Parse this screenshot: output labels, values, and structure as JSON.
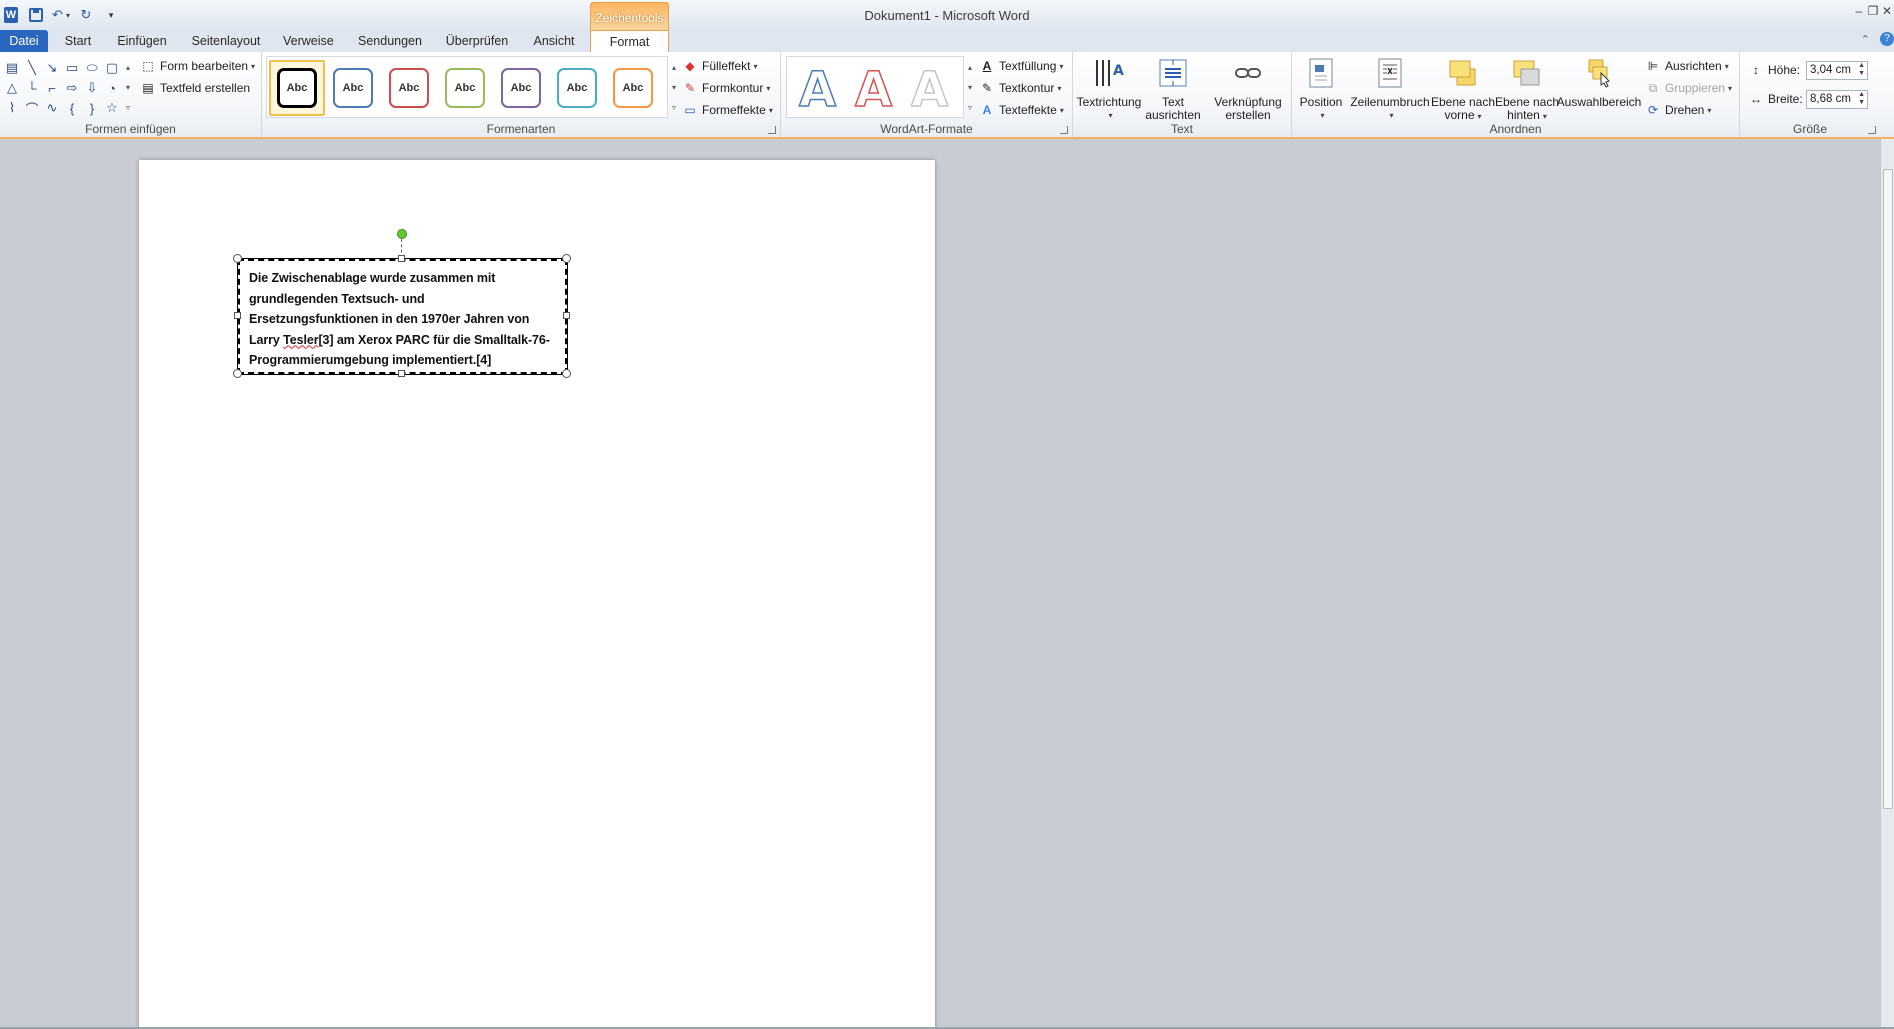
{
  "window": {
    "title": "Dokument1 - Microsoft Word",
    "context_group": "Zeichentools"
  },
  "tabs": [
    "Datei",
    "Start",
    "Einfügen",
    "Seitenlayout",
    "Verweise",
    "Sendungen",
    "Überprüfen",
    "Ansicht",
    "Format"
  ],
  "active_tab": "Format",
  "ribbon": {
    "formen_einfuegen": {
      "label": "Formen einfügen",
      "form_bearbeiten": "Form bearbeiten",
      "textfeld_erstellen": "Textfeld erstellen"
    },
    "formenarten": {
      "label": "Formenarten",
      "style_sample": "Abc",
      "styles": [
        {
          "color": "#000000"
        },
        {
          "color": "#4e7bb5"
        },
        {
          "color": "#c94f4f"
        },
        {
          "color": "#9bbb59"
        },
        {
          "color": "#8064a2"
        },
        {
          "color": "#4bacc6"
        },
        {
          "color": "#f79646"
        }
      ],
      "fuelleffekt": "Fülleffekt",
      "formkontur": "Formkontur",
      "formeffekte": "Formeffekte"
    },
    "wordart": {
      "label": "WordArt-Formate",
      "letter": "A",
      "textfuellung": "Textfüllung",
      "textkontur": "Textkontur",
      "texteffekte": "Texteffekte"
    },
    "text": {
      "label": "Text",
      "textrichtung": "Textrichtung",
      "text_ausrichten_1": "Text",
      "text_ausrichten_2": "ausrichten",
      "verknuepfung_1": "Verknüpfung",
      "verknuepfung_2": "erstellen"
    },
    "anordnen": {
      "label": "Anordnen",
      "position": "Position",
      "zeilenumbruch": "Zeilenumbruch",
      "ebene_vorne_1": "Ebene nach",
      "ebene_vorne_2": "vorne",
      "ebene_hinten_1": "Ebene nach",
      "ebene_hinten_2": "hinten",
      "auswahlbereich": "Auswahlbereich",
      "ausrichten": "Ausrichten",
      "gruppieren": "Gruppieren",
      "drehen": "Drehen"
    },
    "groesse": {
      "label": "Größe",
      "hoehe_label": "Höhe:",
      "hoehe_value": "3,04 cm",
      "breite_label": "Breite:",
      "breite_value": "8,68 cm"
    }
  },
  "document": {
    "textbox": {
      "line1": "Die Zwischenablage wurde zusammen mit",
      "line2": "grundlegenden Textsuch- und",
      "line3": "Ersetzungsfunktionen in den 1970er Jahren von",
      "line4_a": "Larry ",
      "line4_b": "Tesler",
      "line4_c": "[3] am Xerox PARC für die Smalltalk-76-",
      "line5": "Programmierumgebung implementiert.[4]"
    }
  },
  "colors": {
    "accent_blue": "#2a66be",
    "context_orange": "#f0b25f",
    "page_bg": "#ffffff",
    "workspace_bg": "#c9cdd3"
  }
}
